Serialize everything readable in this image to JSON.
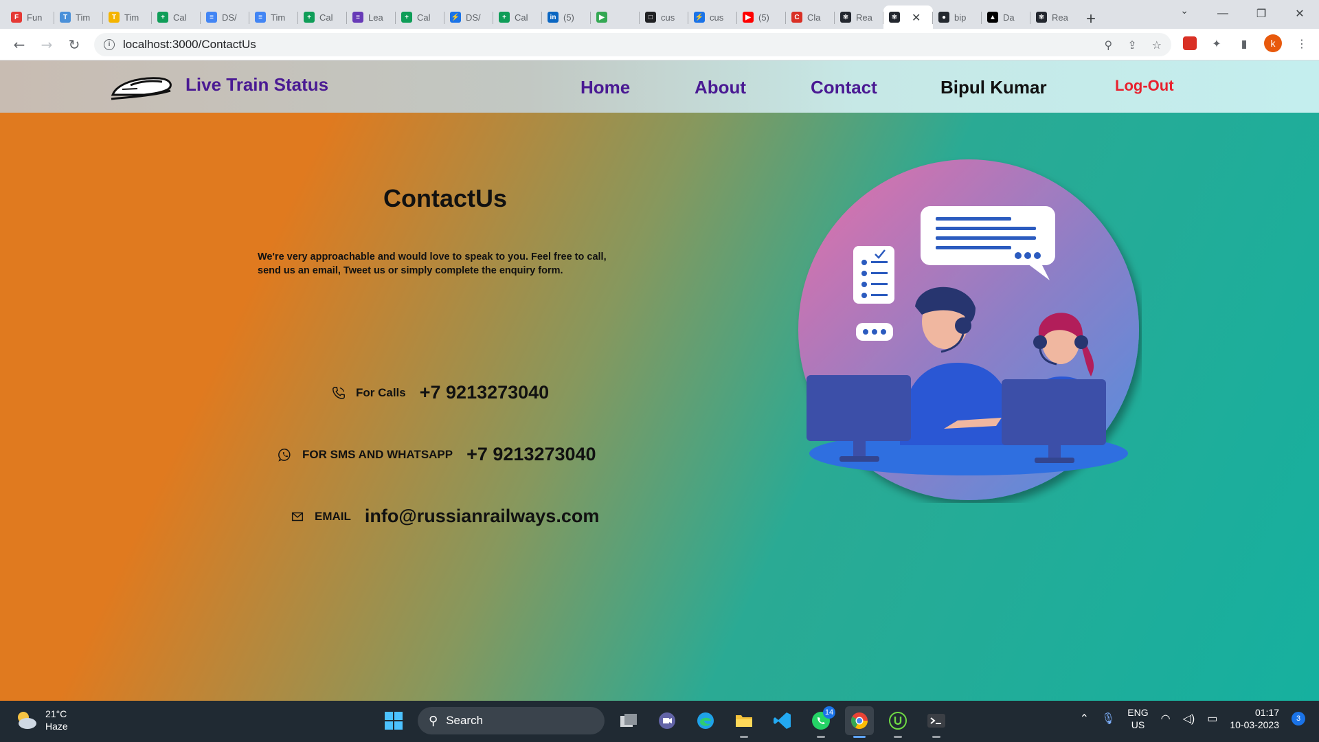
{
  "browser": {
    "tabs": [
      {
        "label": "Fun",
        "fav_color": "#e53935",
        "fav_glyph": "F"
      },
      {
        "label": "Tim",
        "fav_color": "#4a90d9",
        "fav_glyph": "T"
      },
      {
        "label": "Tim",
        "fav_color": "#f4b400",
        "fav_glyph": "T"
      },
      {
        "label": "Cal",
        "fav_color": "#0f9d58",
        "fav_glyph": "+"
      },
      {
        "label": "DS/",
        "fav_color": "#4285f4",
        "fav_glyph": "≡"
      },
      {
        "label": "Tim",
        "fav_color": "#4285f4",
        "fav_glyph": "≡"
      },
      {
        "label": "Cal",
        "fav_color": "#0f9d58",
        "fav_glyph": "+"
      },
      {
        "label": "Lea",
        "fav_color": "#673ab7",
        "fav_glyph": "≡"
      },
      {
        "label": "Cal",
        "fav_color": "#0f9d58",
        "fav_glyph": "+"
      },
      {
        "label": "DS/",
        "fav_color": "#1a73e8",
        "fav_glyph": "⚡"
      },
      {
        "label": "Cal",
        "fav_color": "#0f9d58",
        "fav_glyph": "+"
      },
      {
        "label": "(5)",
        "fav_color": "#0a66c2",
        "fav_glyph": "in"
      },
      {
        "label": "",
        "fav_color": "#34a853",
        "fav_glyph": "▶"
      },
      {
        "label": "cus",
        "fav_color": "#202124",
        "fav_glyph": "□"
      },
      {
        "label": "cus",
        "fav_color": "#1a73e8",
        "fav_glyph": "⚡"
      },
      {
        "label": "(5)",
        "fav_color": "#ff0000",
        "fav_glyph": "▶"
      },
      {
        "label": "Cla",
        "fav_color": "#d93025",
        "fav_glyph": "C"
      },
      {
        "label": "Rea",
        "fav_color": "#23272f",
        "fav_glyph": "⚛"
      },
      {
        "label": "",
        "fav_color": "#23272f",
        "fav_glyph": "⚛"
      },
      {
        "label": "bip",
        "fav_color": "#24292f",
        "fav_glyph": "●"
      },
      {
        "label": "Da",
        "fav_color": "#000000",
        "fav_glyph": "▲"
      },
      {
        "label": "Rea",
        "fav_color": "#23272f",
        "fav_glyph": "⚛"
      }
    ],
    "active_tab_close": "✕",
    "new_tab": "+",
    "url": "localhost:3000/ContactUs",
    "avatar_letter": "k"
  },
  "site": {
    "brand": "Live Train Status",
    "nav": {
      "home": "Home",
      "about": "About",
      "contact": "Contact",
      "user": "Bipul Kumar",
      "logout": "Log-Out"
    },
    "colors": {
      "nav_link": "#4a1a93",
      "logout": "#e8212e",
      "gradient_orange": "#e07a1f",
      "gradient_teal": "#16b09f"
    }
  },
  "contact": {
    "title": "ContactUs",
    "intro": "We're very approachable and would love to speak to you. Feel free to call, send us an email, Tweet us or simply complete the enquiry form.",
    "calls_label": "For Calls",
    "calls_value": "+7 9213273040",
    "sms_label": "FOR SMS AND WHATSAPP",
    "sms_value": "+7 9213273040",
    "email_label": "EMAIL",
    "email_value": "info@russianrailways.com"
  },
  "taskbar": {
    "temperature": "21°C",
    "weather": "Haze",
    "search_label": "Search",
    "whatsapp_badge": "14",
    "lang_line1": "ENG",
    "lang_line2": "US",
    "time": "01:17",
    "date": "10-03-2023",
    "notifications": "3"
  }
}
